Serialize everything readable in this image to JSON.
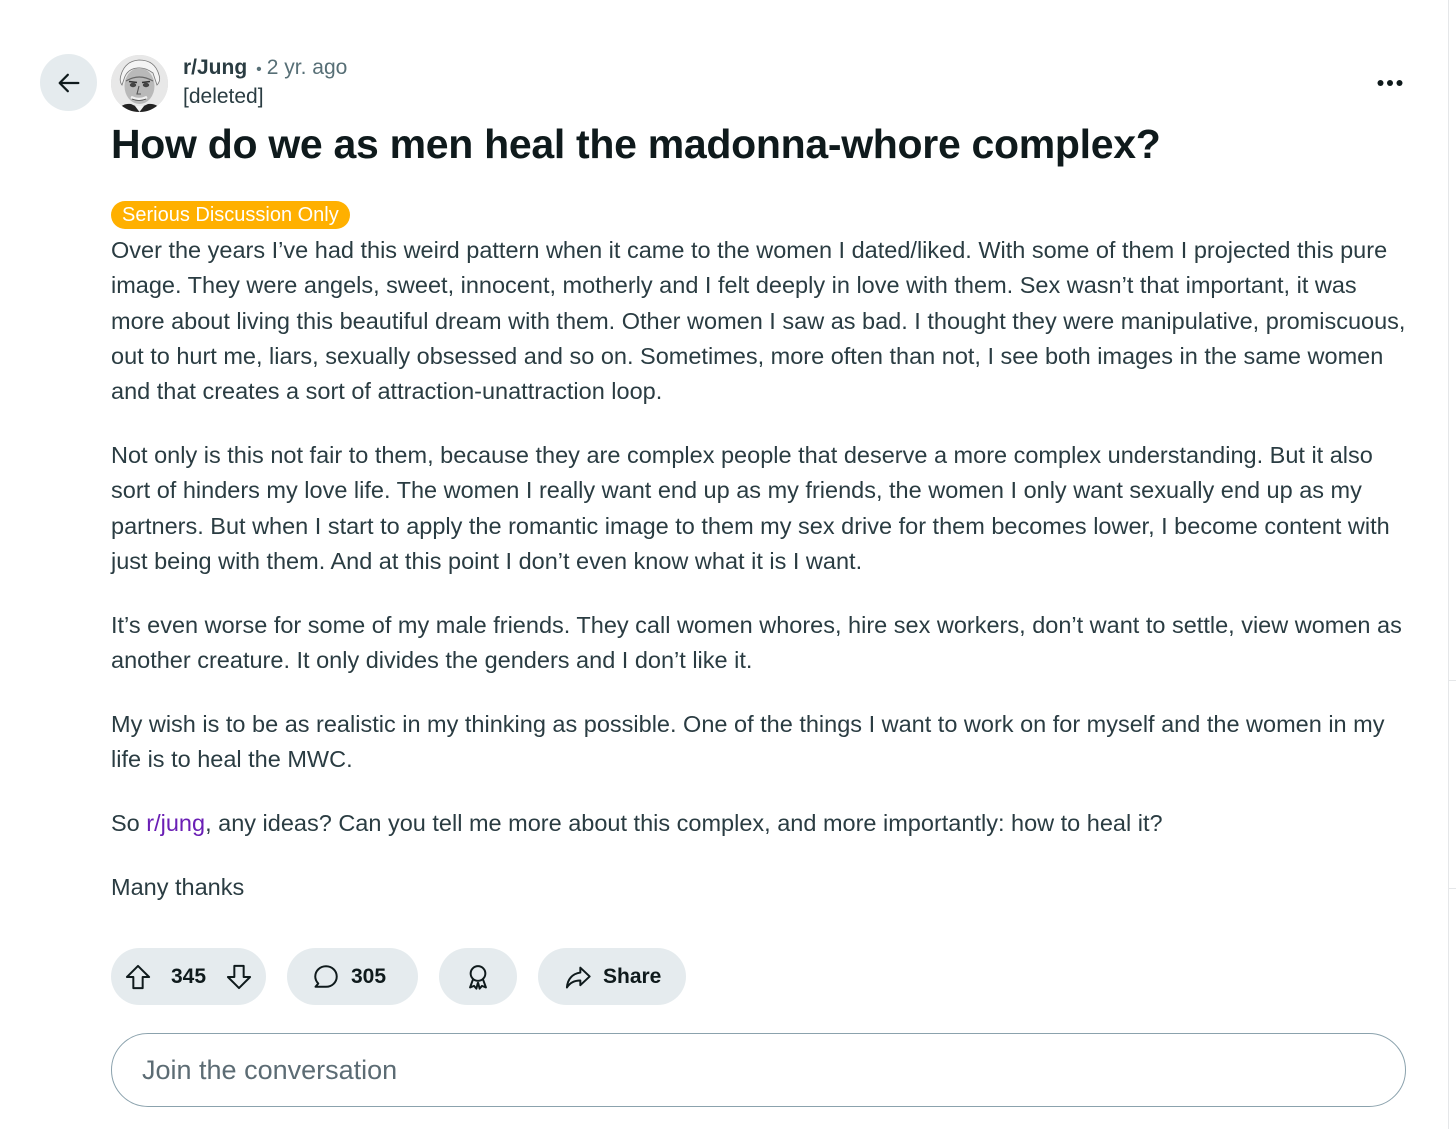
{
  "post": {
    "subreddit": "r/Jung",
    "separator": "•",
    "time": "2 yr. ago",
    "author": "[deleted]",
    "title": "How do we as men heal the madonna-whore complex?",
    "flair": "Serious Discussion Only",
    "flair_color": "#ffb000",
    "paragraphs": [
      "Over the years I’ve had this weird pattern when it came to the women I dated/liked. With some of them I projected this pure image. They were angels, sweet, innocent, motherly and I felt deeply in love with them. Sex wasn’t that important, it was more about living this beautiful dream with them. Other women I saw as bad. I thought they were manipulative, promiscuous, out to hurt me, liars, sexually obsessed and so on. Sometimes, more often than not, I see both images in the same women and that creates a sort of attraction-unattraction loop.",
      "Not only is this not fair to them, because they are complex people that deserve a more complex understanding. But it also sort of hinders my love life. The women I really want end up as my friends, the women I only want sexually end up as my partners. But when I start to apply the romantic image to them my sex drive for them becomes lower, I become content with just being with them. And at this point I don’t even know what it is I want.",
      "It’s even worse for some of my male friends. They call women whores, hire sex workers, don’t want to settle, view women as another creature. It only divides the genders and I don’t like it.",
      "My wish is to be as realistic in my thinking as possible. One of the things I want to work on for myself and the women in my life is to heal the MWC."
    ],
    "closing": {
      "before": "So ",
      "link": "r/jung",
      "after": ", any ideas? Can you tell me more about this complex, and more importantly: how to heal it?"
    },
    "signoff": "Many thanks",
    "link_color": "#6a1fb5"
  },
  "actions": {
    "upvote_icon": "arrow-up-outline-icon",
    "vote_count": "345",
    "downvote_icon": "arrow-down-outline-icon",
    "comment_icon": "speech-bubble-icon",
    "comment_count": "305",
    "award_icon": "award-ribbon-icon",
    "share_icon": "share-arrow-icon",
    "share_label": "Share"
  },
  "comment_input": {
    "placeholder": "Join the conversation"
  },
  "icons": {
    "back": "arrow-left-icon",
    "more": "more-horizontal-icon"
  }
}
